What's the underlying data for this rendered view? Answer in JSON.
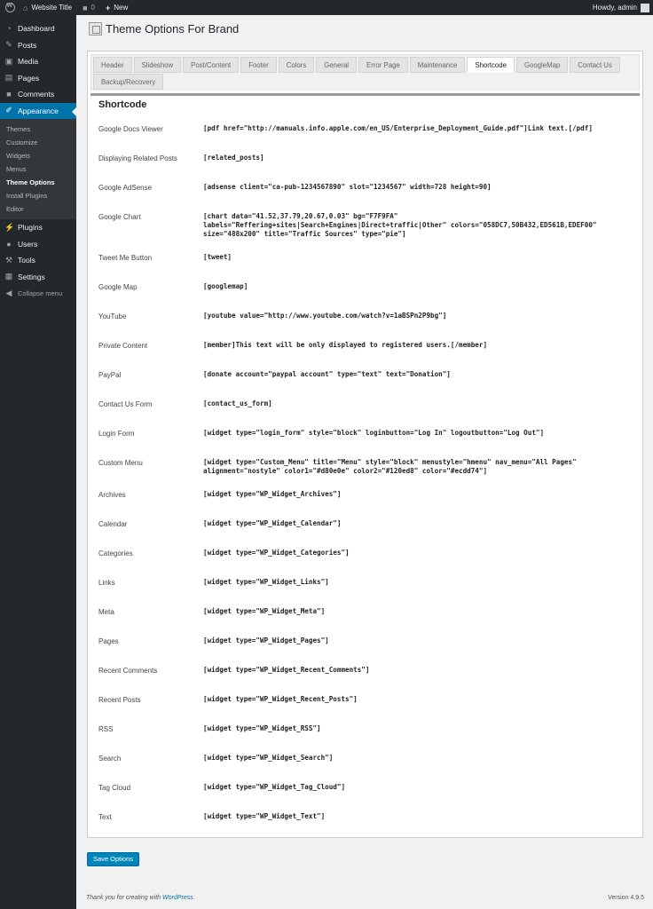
{
  "adminbar": {
    "site_title": "Website Title",
    "comments_count": "0",
    "new_label": "New",
    "howdy": "Howdy, admin"
  },
  "sidebar": {
    "items": [
      {
        "label": "Dashboard",
        "icon": "dashboard-icon"
      },
      {
        "label": "Posts",
        "icon": "pin-icon"
      },
      {
        "label": "Media",
        "icon": "media-icon"
      },
      {
        "label": "Pages",
        "icon": "pages-icon"
      },
      {
        "label": "Comments",
        "icon": "comments-icon"
      },
      {
        "label": "Appearance",
        "icon": "paintbrush-icon"
      }
    ],
    "submenu": [
      "Themes",
      "Customize",
      "Widgets",
      "Menus",
      "Theme Options",
      "Install Plugins",
      "Editor"
    ],
    "items2": [
      {
        "label": "Plugins",
        "icon": "plugin-icon"
      },
      {
        "label": "Users",
        "icon": "users-icon"
      },
      {
        "label": "Tools",
        "icon": "tools-icon"
      },
      {
        "label": "Settings",
        "icon": "settings-icon"
      }
    ],
    "collapse": "Collapse menu"
  },
  "page": {
    "title": "Theme Options For Brand",
    "section_title": "Shortcode",
    "save_label": "Save Options"
  },
  "tabs": [
    "Header",
    "Slideshow",
    "Post/Content",
    "Footer",
    "Colors",
    "General",
    "Error Page",
    "Maintenance",
    "Shortcode",
    "GoogleMap",
    "Contact Us",
    "Backup/Recovery"
  ],
  "active_tab": "Shortcode",
  "rows": [
    {
      "label": "Google Docs Viewer",
      "code": "[pdf href=\"http://manuals.info.apple.com/en_US/Enterprise_Deployment_Guide.pdf\"]Link text.[/pdf]"
    },
    {
      "label": "Displaying Related Posts",
      "code": "[related_posts]"
    },
    {
      "label": "Google AdSense",
      "code": "[adsense client=\"ca-pub-1234567890\" slot=\"1234567\" width=728 height=90]"
    },
    {
      "label": "Google Chart",
      "code": "[chart data=\"41.52,37.79,20.67,0.03\" bg=\"F7F9FA\" labels=\"Reffering+sites|Search+Engines|Direct+traffic|Other\" colors=\"058DC7,50B432,ED561B,EDEF00\" size=\"488x200\" title=\"Traffic Sources\" type=\"pie\"]"
    },
    {
      "label": "Tweet Me Button",
      "code": "[tweet]"
    },
    {
      "label": "Google Map",
      "code": "[googlemap]"
    },
    {
      "label": "YouTube",
      "code": "[youtube value=\"http://www.youtube.com/watch?v=1aBSPn2P9bg\"]"
    },
    {
      "label": "Private Content",
      "code": "[member]This text will be only displayed to registered users.[/member]"
    },
    {
      "label": "PayPal",
      "code": "[donate account=\"paypal account\" type=\"text\" text=\"Donation\"]"
    },
    {
      "label": "Contact Us Form",
      "code": "[contact_us_form]"
    },
    {
      "label": "Login Form",
      "code": "[widget type=\"login_form\" style=\"block\" loginbutton=\"Log In\" logoutbutton=\"Log Out\"]"
    },
    {
      "label": "Custom Menu",
      "code": "[widget type=\"Custom_Menu\" title=\"Menu\" style=\"block\" menustyle=\"hmenu\" nav_menu=\"All Pages\" alignment=\"nostyle\" color1=\"#d80e0e\" color2=\"#120ed8\" color=\"#ecdd74\"]"
    },
    {
      "label": "Archives",
      "code": "[widget type=\"WP_Widget_Archives\"]"
    },
    {
      "label": "Calendar",
      "code": "[widget type=\"WP_Widget_Calendar\"]"
    },
    {
      "label": "Categories",
      "code": "[widget type=\"WP_Widget_Categories\"]"
    },
    {
      "label": "Links",
      "code": "[widget type=\"WP_Widget_Links\"]"
    },
    {
      "label": "Meta",
      "code": "[widget type=\"WP_Widget_Meta\"]"
    },
    {
      "label": "Pages",
      "code": "[widget type=\"WP_Widget_Pages\"]"
    },
    {
      "label": "Recent Comments",
      "code": "[widget type=\"WP_Widget_Recent_Comments\"]"
    },
    {
      "label": "Recent Posts",
      "code": "[widget type=\"WP_Widget_Recent_Posts\"]"
    },
    {
      "label": "RSS",
      "code": "[widget type=\"WP_Widget_RSS\"]"
    },
    {
      "label": "Search",
      "code": "[widget type=\"WP_Widget_Search\"]"
    },
    {
      "label": "Tag Cloud",
      "code": "[widget type=\"WP_Widget_Tag_Cloud\"]"
    },
    {
      "label": "Text",
      "code": "[widget type=\"WP_Widget_Text\"]"
    }
  ],
  "footer": {
    "thanks_prefix": "Thank you for creating with ",
    "wordpress_link": "WordPress",
    "thanks_suffix": ".",
    "version": "Version 4.9.5"
  }
}
